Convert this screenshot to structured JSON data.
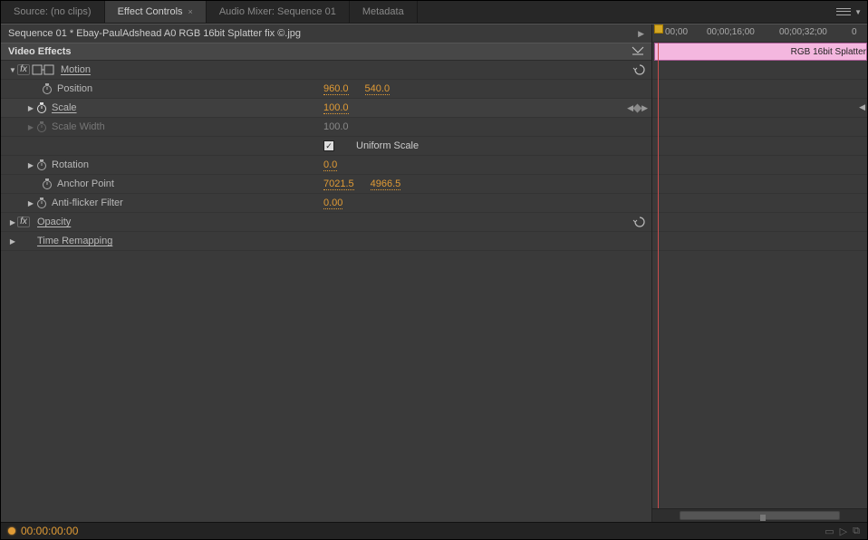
{
  "tabs": {
    "source": "Source: (no clips)",
    "effect_controls": "Effect Controls",
    "audio_mixer": "Audio Mixer: Sequence 01",
    "metadata": "Metadata"
  },
  "clip_title": "Sequence 01 * Ebay-PaulAdshead A0 RGB 16bit Splatter fix ©.jpg",
  "video_effects_header": "Video Effects",
  "motion": {
    "label": "Motion",
    "position": {
      "label": "Position",
      "x": "960.0",
      "y": "540.0"
    },
    "scale": {
      "label": "Scale",
      "value": "100.0"
    },
    "scale_width": {
      "label": "Scale Width",
      "value": "100.0"
    },
    "uniform_scale": "Uniform Scale",
    "rotation": {
      "label": "Rotation",
      "value": "0.0"
    },
    "anchor": {
      "label": "Anchor Point",
      "x": "7021.5",
      "y": "4966.5"
    },
    "antiflicker": {
      "label": "Anti-flicker Filter",
      "value": "0.00"
    }
  },
  "opacity": {
    "label": "Opacity"
  },
  "time_remap": {
    "label": "Time Remapping"
  },
  "timeline": {
    "ticks": [
      "00;00",
      "00;00;16;00",
      "00;00;32;00"
    ],
    "clip_label": "RGB 16bit Splatter"
  },
  "footer": {
    "timecode": "00:00:00:00"
  }
}
